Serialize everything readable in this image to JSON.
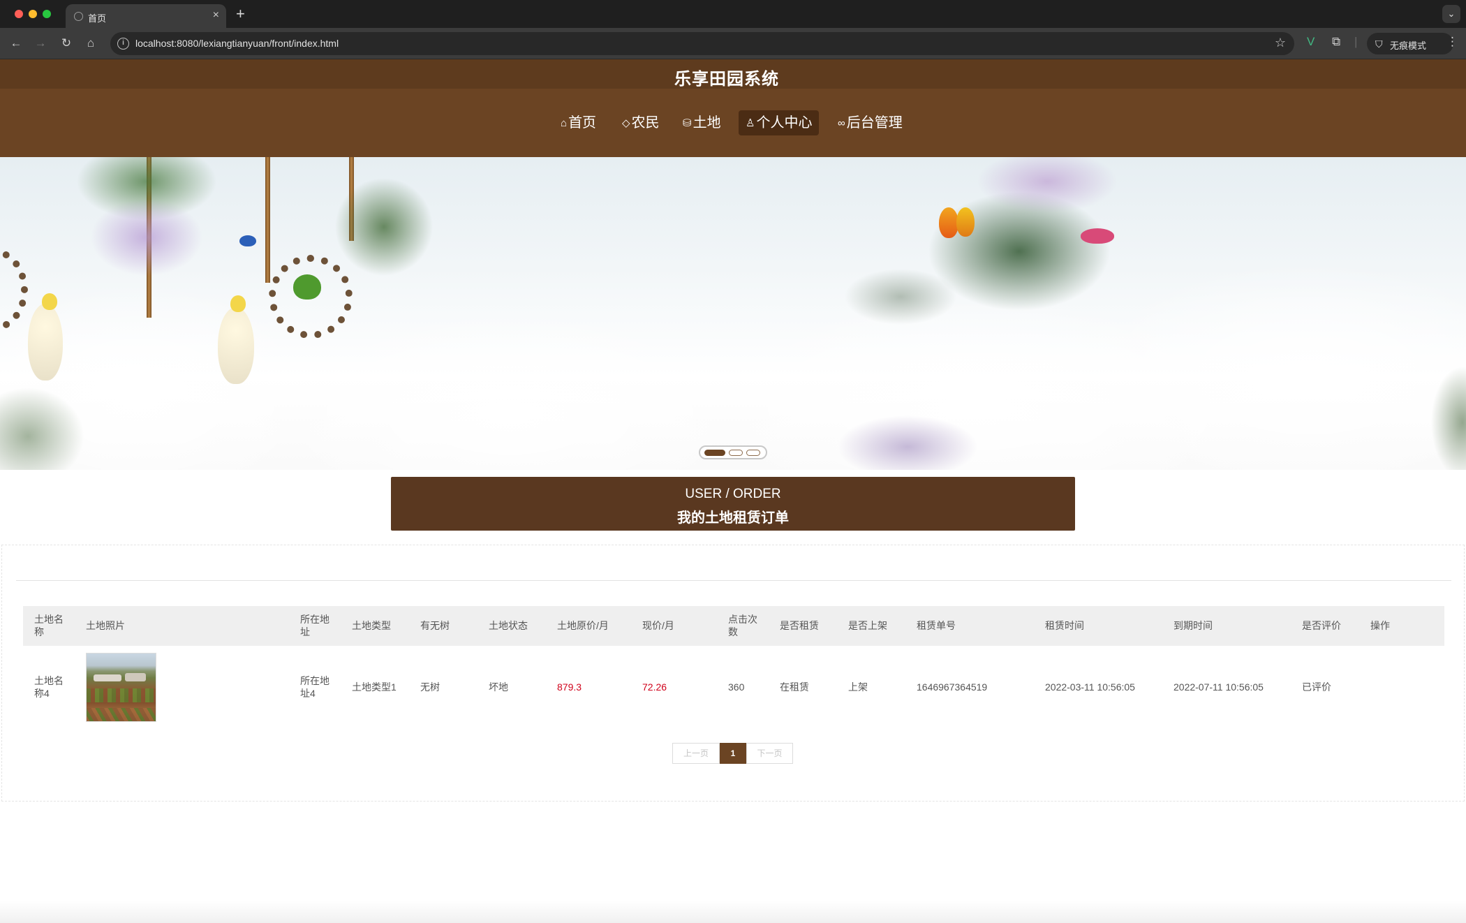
{
  "browser": {
    "tab_title": "首页",
    "tab_close": "×",
    "new_tab": "+",
    "url": "localhost:8080/lexiangtianyuan/front/index.html",
    "incognito_label": "无痕模式"
  },
  "site": {
    "title": "乐享田园系统"
  },
  "nav": {
    "items": [
      {
        "icon": "home-icon",
        "label": "首页"
      },
      {
        "icon": "tag-icon",
        "label": "农民"
      },
      {
        "icon": "database-icon",
        "label": "土地"
      },
      {
        "icon": "user-icon",
        "label": "个人中心",
        "active": true
      },
      {
        "icon": "link-icon",
        "label": "后台管理"
      }
    ]
  },
  "banner": {
    "slides": 3,
    "active_slide": 1
  },
  "section": {
    "title_en": "USER / ORDER",
    "title_cn": "我的土地租赁订单"
  },
  "table": {
    "headers": [
      "土地名称",
      "土地照片",
      "所在地址",
      "土地类型",
      "有无树",
      "土地状态",
      "土地原价/月",
      "现价/月",
      "点击次数",
      "是否租赁",
      "是否上架",
      "租赁单号",
      "租赁时间",
      "到期时间",
      "是否评价",
      "操作"
    ],
    "rows": [
      {
        "name": "土地名称4",
        "address": "所在地址4",
        "type": "土地类型1",
        "trees": "无树",
        "status": "坏地",
        "original_price": "879.3",
        "current_price": "72.26",
        "clicks": "360",
        "leased": "在租赁",
        "listed": "上架",
        "order_no": "1646967364519",
        "lease_time": "2022-03-11 10:56:05",
        "expire_time": "2022-07-11 10:56:05",
        "reviewed": "已评价"
      }
    ]
  },
  "pagination": {
    "prev": "上一页",
    "current": "1",
    "next": "下一页"
  },
  "colors": {
    "brand_brown": "#6b4423",
    "dark_brown": "#5a3820",
    "price_red": "#d0021b"
  }
}
